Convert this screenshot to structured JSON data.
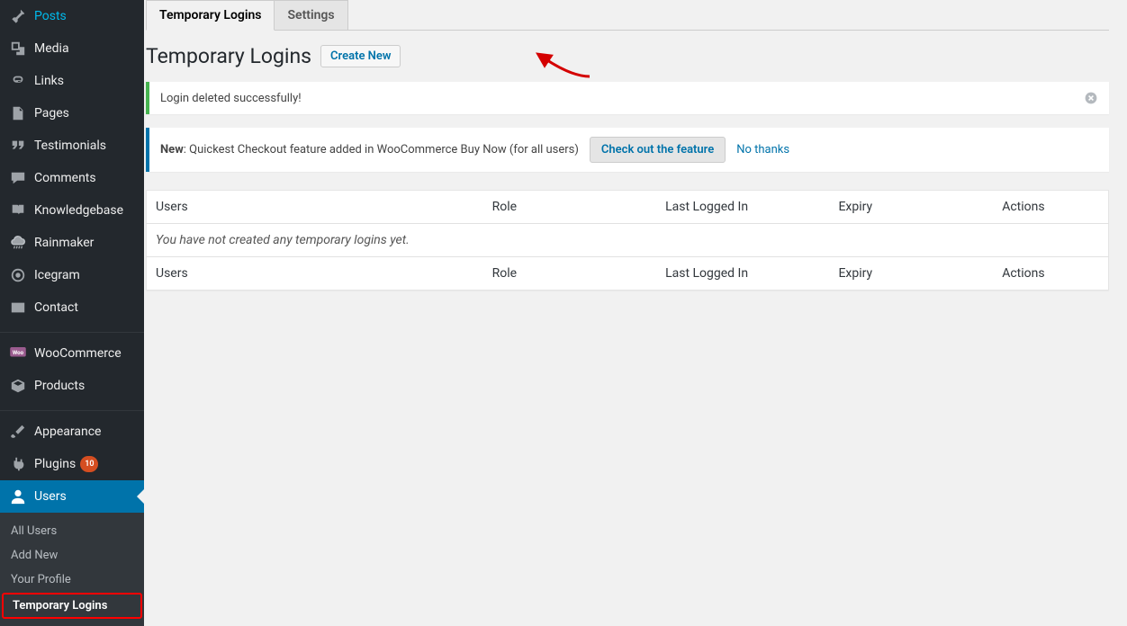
{
  "sidebar": {
    "items": [
      {
        "label": "Posts"
      },
      {
        "label": "Media"
      },
      {
        "label": "Links"
      },
      {
        "label": "Pages"
      },
      {
        "label": "Testimonials"
      },
      {
        "label": "Comments"
      },
      {
        "label": "Knowledgebase"
      },
      {
        "label": "Rainmaker"
      },
      {
        "label": "Icegram"
      },
      {
        "label": "Contact"
      },
      {
        "label": "WooCommerce"
      },
      {
        "label": "Products"
      },
      {
        "label": "Appearance"
      },
      {
        "label": "Plugins",
        "badge": "10"
      },
      {
        "label": "Users"
      }
    ],
    "submenu": [
      {
        "label": "All Users"
      },
      {
        "label": "Add New"
      },
      {
        "label": "Your Profile"
      },
      {
        "label": "Temporary Logins"
      }
    ]
  },
  "tabs": {
    "temp": "Temporary Logins",
    "settings": "Settings"
  },
  "heading": "Temporary Logins",
  "create_new": "Create New",
  "notice": {
    "text": "Login deleted successfully!"
  },
  "promo": {
    "new": "New",
    "text": ": Quickest Checkout feature added in WooCommerce Buy Now (for all users)",
    "cta": "Check out the feature",
    "dismiss": "No thanks"
  },
  "table": {
    "cols": {
      "users": "Users",
      "role": "Role",
      "last": "Last Logged In",
      "expiry": "Expiry",
      "actions": "Actions"
    },
    "empty": "You have not created any temporary logins yet."
  }
}
